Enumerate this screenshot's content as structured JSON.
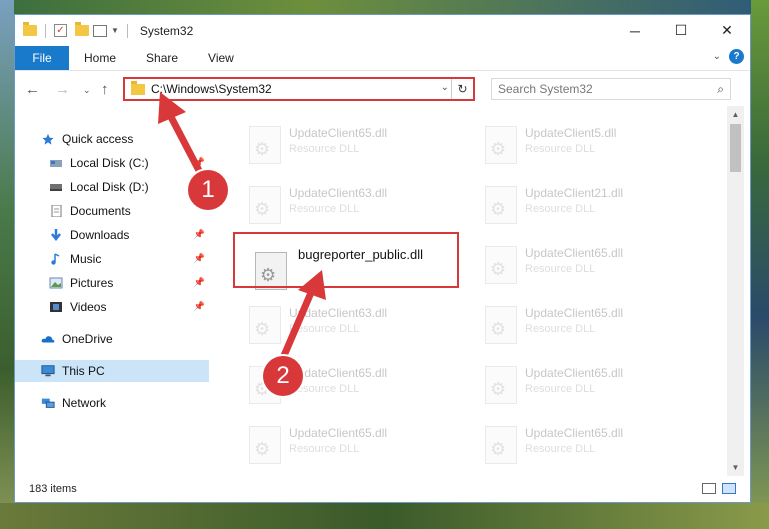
{
  "window": {
    "title": "System32",
    "controls": {
      "minimize": "─",
      "maximize": "☐",
      "close": "✕"
    }
  },
  "ribbon": {
    "tabs": [
      "File",
      "Home",
      "Share",
      "View"
    ],
    "help": "?"
  },
  "address": {
    "path": "C:\\Windows\\System32",
    "search_placeholder": "Search System32"
  },
  "nav": {
    "items": [
      {
        "label": "Quick access",
        "icon": "star-icon",
        "pinned": false
      },
      {
        "label": "Local Disk (C:)",
        "icon": "drive-icon",
        "pinned": true
      },
      {
        "label": "Local Disk (D:)",
        "icon": "drive-icon",
        "pinned": false
      },
      {
        "label": "Documents",
        "icon": "documents-icon",
        "pinned": false
      },
      {
        "label": "Downloads",
        "icon": "downloads-icon",
        "pinned": true
      },
      {
        "label": "Music",
        "icon": "music-icon",
        "pinned": true
      },
      {
        "label": "Pictures",
        "icon": "pictures-icon",
        "pinned": true
      },
      {
        "label": "Videos",
        "icon": "videos-icon",
        "pinned": true
      },
      {
        "label": "OneDrive",
        "icon": "onedrive-icon",
        "pinned": false
      },
      {
        "label": "This PC",
        "icon": "this-pc-icon",
        "pinned": false
      },
      {
        "label": "Network",
        "icon": "network-icon",
        "pinned": false
      }
    ]
  },
  "files": {
    "highlighted": "bugreporter_public.dll",
    "left_column": [
      "UpdateClient65.dll",
      "UpdateClient63.dll",
      "UpdateClient63.dll",
      "UpdateClient65.dll",
      "UpdateClient65.dll"
    ],
    "right_column": [
      "UpdateClient5.dll",
      "UpdateClient21.dll",
      "UpdateClient65.dll",
      "UpdateClient65.dll",
      "UpdateClient65.dll",
      "UpdateClient65.dll"
    ],
    "type": "Resource DLL"
  },
  "status": {
    "count": "183 items"
  },
  "annotations": {
    "step1": "1",
    "step2": "2",
    "color": "#d9383a"
  }
}
